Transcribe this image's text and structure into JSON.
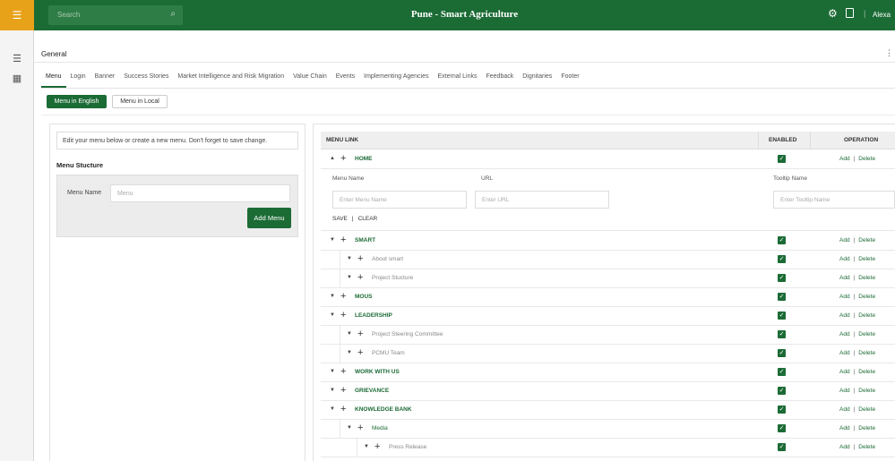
{
  "app": {
    "title": "Pune - Smart Agriculture",
    "search_placeholder": "Search",
    "user_name": "Alexa",
    "brand_color": "#1b6b35",
    "accent_color": "#e8a21a"
  },
  "sidebar": {
    "icons": [
      "hamburger-icon",
      "list-icon",
      "grid-icon"
    ]
  },
  "section_title": "General",
  "tabs": [
    {
      "label": "Menu",
      "active": true
    },
    {
      "label": "Login"
    },
    {
      "label": "Banner"
    },
    {
      "label": "Success Stories"
    },
    {
      "label": "Market Intelligence and Risk Migration"
    },
    {
      "label": "Value Chain"
    },
    {
      "label": "Events"
    },
    {
      "label": "Implementing Agencies"
    },
    {
      "label": "External Links"
    },
    {
      "label": "Feedback"
    },
    {
      "label": "Dignitaries"
    },
    {
      "label": "Footer"
    }
  ],
  "lang_buttons": {
    "english": "Menu in English",
    "local": "Menu in Local"
  },
  "left_panel": {
    "help_text": "Edit your menu below or create a new menu. Don't forget to save change.",
    "structure_title": "Menu Stucture",
    "menu_name_label": "Menu Name",
    "menu_name_placeholder": "Menu",
    "add_menu_button": "Add Menu"
  },
  "table": {
    "headers": {
      "menu_link": "MENU LINK",
      "enabled": "ENABLED",
      "operation": "OPERATION"
    },
    "add_label": "Add",
    "delete_label": "Delete",
    "separator": "|",
    "edit_form": {
      "menu_name_label": "Menu Name",
      "url_label": "URL",
      "tooltip_label": "Tooltip Name",
      "menu_name_placeholder": "Enter Menu Name",
      "url_placeholder": "Enter URL",
      "tooltip_placeholder": "Enter Tooltip Name",
      "save": "SAVE",
      "clear": "CLEAR",
      "sep": "|"
    },
    "rows": [
      {
        "label": "HOME",
        "level": 0,
        "caret": "▲",
        "enabled": true
      },
      {
        "label": "SMART",
        "level": 0,
        "caret": "▼",
        "enabled": true
      },
      {
        "label": "About smart",
        "level": 1,
        "caret": "▼",
        "enabled": true
      },
      {
        "label": "Project Stucture",
        "level": 1,
        "caret": "▼",
        "enabled": true
      },
      {
        "label": "MOUS",
        "level": 0,
        "caret": "▼",
        "enabled": true
      },
      {
        "label": "LEADERSHIP",
        "level": 0,
        "caret": "▼",
        "enabled": true
      },
      {
        "label": "Project Steering Committee",
        "level": 1,
        "caret": "▼",
        "enabled": true
      },
      {
        "label": "PCMU Team",
        "level": 1,
        "caret": "▼",
        "enabled": true
      },
      {
        "label": "WORK WITH US",
        "level": 0,
        "caret": "▼",
        "enabled": true
      },
      {
        "label": "GRIEVANCE",
        "level": 0,
        "caret": "▼",
        "enabled": true
      },
      {
        "label": "KNOWLEDGE BANK",
        "level": 0,
        "caret": "▼",
        "enabled": true
      },
      {
        "label": "Media",
        "level": 1,
        "caret": "▼",
        "enabled": true,
        "green": true
      },
      {
        "label": "Press Release",
        "level": 2,
        "caret": "▼",
        "enabled": true
      }
    ]
  }
}
